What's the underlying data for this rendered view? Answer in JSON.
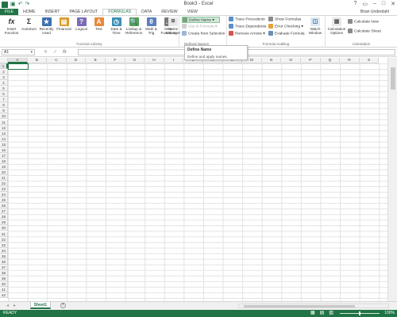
{
  "window": {
    "title": "Book3 - Excel",
    "qat_icons": [
      "save-icon",
      "undo-icon",
      "redo-icon"
    ],
    "controls": [
      "?",
      "▭",
      "–",
      "□",
      "✕"
    ]
  },
  "tabs": [
    "FILE",
    "HOME",
    "INSERT",
    "PAGE LAYOUT",
    "FORMULAS",
    "DATA",
    "REVIEW",
    "VIEW"
  ],
  "active_tab": "FORMULAS",
  "user": "Brian Underdahl",
  "ribbon": {
    "function_library": {
      "label": "Function Library",
      "buttons": [
        {
          "name": "insert-function",
          "label": "Insert Function",
          "glyph": "fx"
        },
        {
          "name": "autosum",
          "label": "AutoSum",
          "glyph": "Σ"
        },
        {
          "name": "recently-used",
          "label": "Recently Used",
          "glyph": "★"
        },
        {
          "name": "financial",
          "label": "Financial",
          "glyph": "▤"
        },
        {
          "name": "logical",
          "label": "Logical",
          "glyph": "?"
        },
        {
          "name": "text",
          "label": "Text",
          "glyph": "A"
        },
        {
          "name": "date-time",
          "label": "Date & Time",
          "glyph": "◷"
        },
        {
          "name": "lookup-reference",
          "label": "Lookup & Reference",
          "glyph": "🔍"
        },
        {
          "name": "math-trig",
          "label": "Math & Trig",
          "glyph": "θ"
        },
        {
          "name": "more-functions",
          "label": "More Functions",
          "glyph": "…"
        }
      ]
    },
    "defined_names": {
      "label": "Defined Names",
      "name_manager": "Name Manager",
      "define_name": "Define Name",
      "use_in_formula": "Use in Formula",
      "create_from_selection": "Create from Selection"
    },
    "formula_auditing": {
      "label": "Formula Auditing",
      "trace_precedents": "Trace Precedents",
      "trace_dependents": "Trace Dependents",
      "remove_arrows": "Remove Arrows",
      "show_formulas": "Show Formulas",
      "error_checking": "Error Checking",
      "evaluate_formula": "Evaluate Formula",
      "watch_window": "Watch Window"
    },
    "calculation": {
      "label": "Calculation",
      "calculation_options": "Calculation Options",
      "calculate_now": "Calculate Now",
      "calculate_sheet": "Calculate Sheet"
    }
  },
  "tooltip": {
    "title": "Define Name",
    "description": "Define and apply names."
  },
  "formula_bar": {
    "name_box": "A1",
    "cancel": "✕",
    "enter": "✓",
    "fx": "fx",
    "value": ""
  },
  "columns": [
    "A",
    "B",
    "C",
    "D",
    "E",
    "F",
    "G",
    "H",
    "I",
    "J",
    "K",
    "L",
    "M",
    "N",
    "O",
    "P",
    "Q",
    "R",
    "S"
  ],
  "row_count": 42,
  "sheet_tab": "Sheet1",
  "status": {
    "text": "READY",
    "zoom": "100%"
  },
  "colors": {
    "accent": "#217346",
    "selection_highlight": "#cde8d4"
  }
}
